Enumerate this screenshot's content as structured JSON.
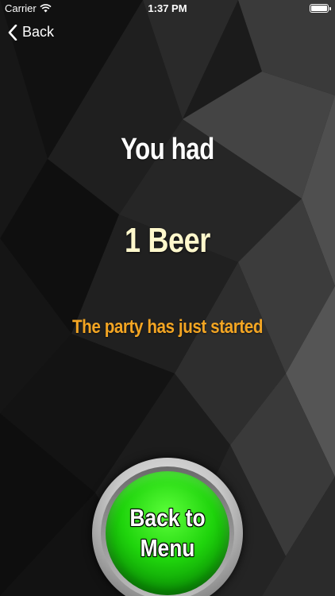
{
  "status_bar": {
    "carrier": "Carrier",
    "time": "1:37 PM",
    "battery_level": 1.0
  },
  "nav": {
    "back_label": "Back"
  },
  "result": {
    "heading": "You had",
    "count_text": "1 Beer",
    "message": "The party has just started"
  },
  "menu_button": {
    "line1": "Back to",
    "line2": "Menu"
  },
  "colors": {
    "message": "#f3a523",
    "count": "#fff8cc",
    "button_green": "#1fd40c",
    "background": "#1a1a1a"
  }
}
